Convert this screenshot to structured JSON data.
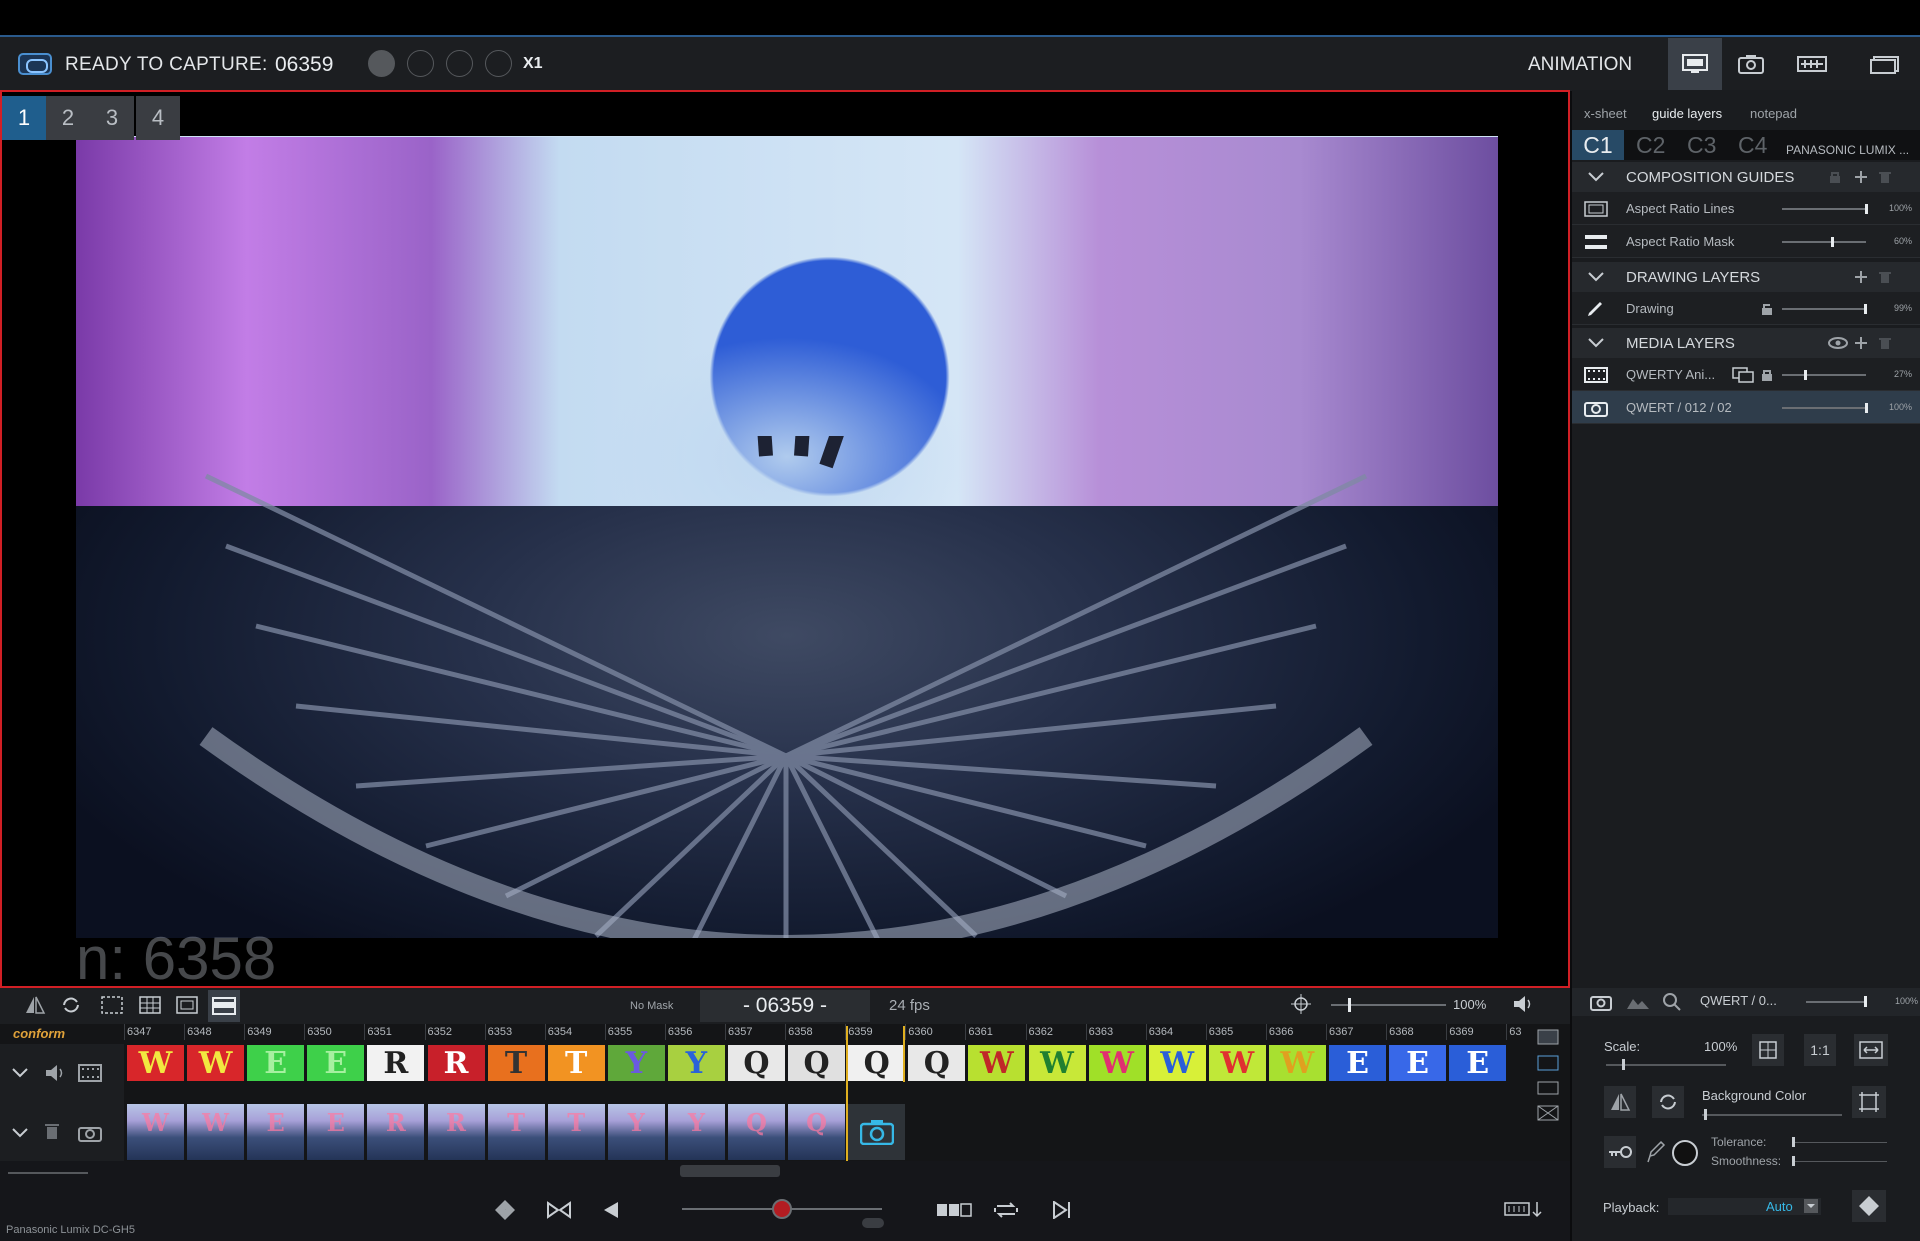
{
  "topbar": {
    "status_label": "READY TO CAPTURE:",
    "frame": "06359",
    "multiplier": "X1",
    "mode": "ANIMATION"
  },
  "viewer": {
    "tabs": [
      "1",
      "2",
      "3",
      "4"
    ],
    "overlay_text": "n: 6358"
  },
  "right_panel": {
    "tabs": [
      "x-sheet",
      "guide layers",
      "notepad"
    ],
    "cams": [
      "C1",
      "C2",
      "C3",
      "C4"
    ],
    "camera_name": "PANASONIC LUMIX ...",
    "composition": {
      "header": "COMPOSITION GUIDES",
      "rows": [
        {
          "label": "Aspect Ratio Lines",
          "pct": "100%",
          "level": 1.0
        },
        {
          "label": "Aspect Ratio Mask",
          "pct": "60%",
          "level": 0.6
        }
      ]
    },
    "drawing": {
      "header": "DRAWING LAYERS",
      "rows": [
        {
          "label": "Drawing",
          "pct": "99%",
          "level": 0.99
        }
      ]
    },
    "media": {
      "header": "MEDIA LAYERS",
      "rows": [
        {
          "label": "QWERTY Ani...",
          "pct": "27%",
          "level": 0.27
        },
        {
          "label": "QWERT / 012 / 02",
          "pct": "100%",
          "level": 1.0
        }
      ]
    }
  },
  "toolbar": {
    "mask": "No Mask",
    "timecode": "- 06359 -",
    "fps": "24 fps",
    "zoom": "100%"
  },
  "timeline": {
    "track_label": "conform",
    "frames": [
      "6347",
      "6348",
      "6349",
      "6350",
      "6351",
      "6352",
      "6353",
      "6354",
      "6355",
      "6356",
      "6357",
      "6358",
      "6359",
      "6360",
      "6361",
      "6362",
      "6363",
      "6364",
      "6365",
      "6366",
      "6367",
      "6368",
      "6369",
      "63"
    ],
    "letters": [
      "W",
      "W",
      "E",
      "E",
      "R",
      "R",
      "T",
      "T",
      "Y",
      "Y",
      "Q",
      "Q",
      "Q",
      "Q",
      "W",
      "W",
      "W",
      "W",
      "W",
      "W",
      "E",
      "E",
      "E"
    ],
    "thumbs": [
      "W",
      "W",
      "E",
      "E",
      "R",
      "R",
      "T",
      "T",
      "Y",
      "Y",
      "Q",
      "Q"
    ]
  },
  "bottom_right": {
    "layer_name": "QWERT / 0...",
    "layer_pct": "100%",
    "scale_label": "Scale:",
    "scale_value": "100%",
    "one_to_one": "1:1",
    "bg_color": "Background Color",
    "tolerance": "Tolerance:",
    "smoothness": "Smoothness:",
    "playback_label": "Playback:",
    "playback_value": "Auto"
  },
  "status": {
    "device": "Panasonic Lumix DC-GH5"
  },
  "colors": {
    "accent": "#36b8e6",
    "record": "#d11f25",
    "playhead": "#e0b020",
    "conform": "#e0a23a"
  }
}
